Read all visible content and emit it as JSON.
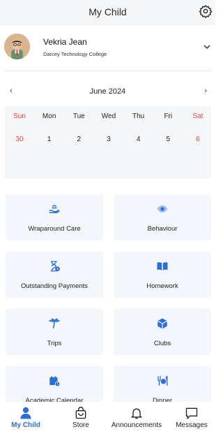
{
  "header": {
    "title": "My Child"
  },
  "profile": {
    "name": "Vekria Jean",
    "school": "Darcey Technology College"
  },
  "calendar": {
    "month": "June 2024",
    "prev": "‹",
    "next": "›",
    "weekdays": [
      "Sun",
      "Mon",
      "Tue",
      "Wed",
      "Thu",
      "Fri",
      "Sat"
    ],
    "dates": [
      "30",
      "1",
      "2",
      "3",
      "4",
      "5",
      "6"
    ]
  },
  "tiles": [
    {
      "label": "Wraparound Care",
      "icon": "hand-care-icon"
    },
    {
      "label": "Behaviour",
      "icon": "eye-icon"
    },
    {
      "label": "Outstanding Payments",
      "icon": "hourglass-payment-icon"
    },
    {
      "label": "Homework",
      "icon": "book-icon"
    },
    {
      "label": "Trips",
      "icon": "palm-tree-icon"
    },
    {
      "label": "Clubs",
      "icon": "cube-icon"
    },
    {
      "label": "Academic Calendar",
      "icon": "calendar-icon"
    },
    {
      "label": "Dinner",
      "icon": "dinner-icon"
    }
  ],
  "nav": [
    {
      "label": "My Child",
      "icon": "person-icon",
      "active": true
    },
    {
      "label": "Store",
      "icon": "shopping-bag-icon"
    },
    {
      "label": "Announcements",
      "icon": "bell-icon"
    },
    {
      "label": "Messages",
      "icon": "chat-icon"
    }
  ],
  "colors": {
    "accent": "#2f6fd0",
    "weekend": "#e0463d",
    "tile_bg": "#f3f6fa"
  }
}
